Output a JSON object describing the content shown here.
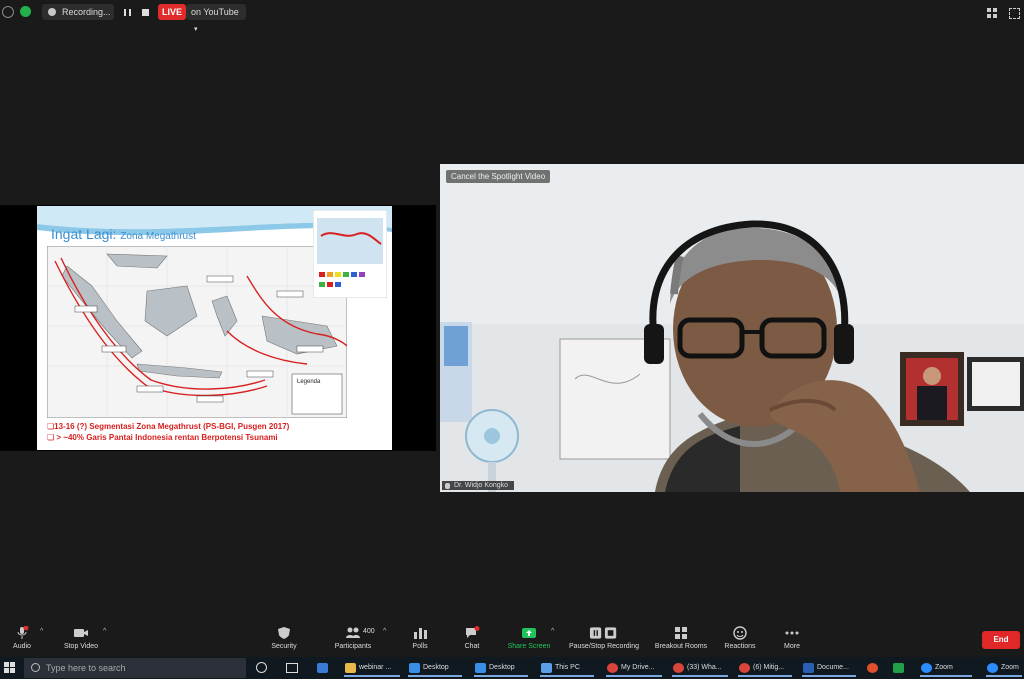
{
  "top_bar": {
    "recording_label": "Recording...",
    "live_label": "LIVE",
    "live_destination": "on YouTube"
  },
  "slide": {
    "title": "Ingat Lagi:",
    "title_sub": "Zona Megathrust",
    "bullet_1": "❏13-16 (?) Segmentasi Zona Megathrust  (PS-BGI, Pusgen 2017)",
    "bullet_2": "❏ > ~40% Garis Pantai Indonesia rentan Berpotensi Tsunami",
    "legend_title": "Legenda"
  },
  "video": {
    "spotlight_button": "Cancel the Spotlight Video",
    "participant_name": "Dr. Widjo Kongko"
  },
  "toolbar": {
    "audio": "Audio",
    "stop_video": "Stop Video",
    "security": "Security",
    "participants": "Participants",
    "participants_count": "400",
    "polls": "Polls",
    "chat": "Chat",
    "share_screen": "Share Screen",
    "pause_stop_recording": "Pause/Stop Recording",
    "breakout_rooms": "Breakout Rooms",
    "reactions": "Reactions",
    "more": "More",
    "end": "End",
    "colors": {
      "share_green": "#21c45a",
      "end_red": "#e02828",
      "badge_red": "#e02b2b"
    }
  },
  "taskbar": {
    "search_placeholder": "Type here to search",
    "items": [
      {
        "label": "webinar ..."
      },
      {
        "label": "Desktop"
      },
      {
        "label": "Desktop"
      },
      {
        "label": "This PC"
      },
      {
        "label": "My Drive..."
      },
      {
        "label": "(33) Wha..."
      },
      {
        "label": "(6) Mitig..."
      },
      {
        "label": "Docume..."
      },
      {
        "label": "Zoom"
      },
      {
        "label": "Zoom"
      }
    ]
  }
}
